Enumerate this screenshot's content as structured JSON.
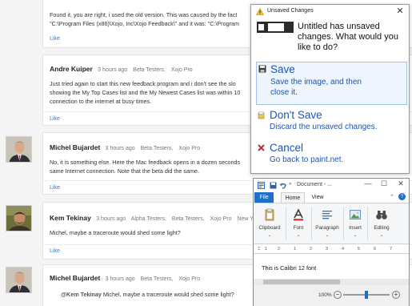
{
  "thread": {
    "card1": {
      "lines": [
        "Found it, you are right, i used the old version. This was caused by the fact",
        "\"C:\\Program Files (x86)\\Xojo, Inc\\Xojo Feedback\\\" and it was: \"C:\\Program"
      ],
      "like": "Like"
    },
    "card2": {
      "name": "Andre Kuiper",
      "time": "3 hours ago",
      "tag1": "Beta Testers,",
      "tag2": "Xojo Pro",
      "lines": [
        "Just tried again to start this new feedback program and i don't see the slo",
        "showing the My Top Cases list and the My Newest Cases list was within 10",
        "connection to the internet at busy times."
      ],
      "like": "Like"
    },
    "card3": {
      "name": "Michel Bujardet",
      "time": "3 hours ago",
      "tag1": "Beta Testers,",
      "tag2": "Xojo Pro",
      "lines": [
        "No, it is something else. Here the Mac feedback opens in a dozen seconds",
        "same Internet connection. Note that the beta did the same."
      ],
      "like": "Like"
    },
    "card4": {
      "name": "Kem Tekinay",
      "time": "3 hours ago",
      "tag1": "Alpha Testers,",
      "tag2": "Beta Testers,",
      "tag3": "Xojo Pro",
      "location": "New York",
      "lines": [
        "Michel, maybe a traceroute would shed some light?"
      ],
      "like": "Like"
    },
    "card5": {
      "name": "Michel Bujardet",
      "time": "3 hours ago",
      "tag1": "Beta Testers,",
      "tag2": "Xojo Pro",
      "reply_mention": "@Kem Tekinay",
      "reply_text": "Michel, maybe a traceroute would shed some light?"
    }
  },
  "dialog": {
    "title": "Unsaved Changes",
    "close": "✕",
    "message": "Untitled has unsaved changes. What would you like to do?",
    "save_title": "Save",
    "save_desc_1": "Save the image, and then",
    "save_desc_2": "close it.",
    "dontsave_title": "Don't Save",
    "dontsave_desc": "Discard the unsaved changes.",
    "cancel_title": "Cancel",
    "cancel_desc": "Go back to paint.net."
  },
  "paint": {
    "doc_title": "Document - ...",
    "tabs": {
      "file": "File",
      "home": "Home",
      "view": "View"
    },
    "groups": [
      {
        "label": "Clipboard",
        "caret": "⌄"
      },
      {
        "label": "Font",
        "caret": "⌄"
      },
      {
        "label": "Paragraph",
        "caret": "⌄"
      },
      {
        "label": "Insert",
        "caret": "⌄"
      },
      {
        "label": "Editing",
        "caret": "⌄"
      }
    ],
    "ruler_marks": [
      "1",
      "2",
      "1",
      "2",
      "3",
      "4",
      "5",
      "6",
      "7"
    ],
    "canvas_text": "This is Calibri 12 font",
    "zoom": "100%",
    "zoom_minus": "−",
    "zoom_plus": "+"
  },
  "colors": {
    "accent": "#1a56b5",
    "file_tab": "#1e6fc8",
    "like_link": "#3a78c2"
  }
}
